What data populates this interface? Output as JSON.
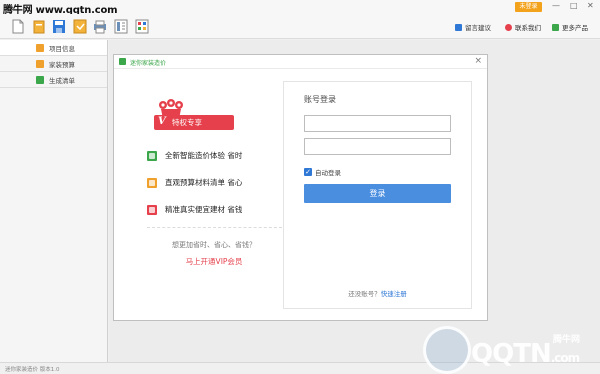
{
  "watermark_top": "腾牛网 www.qqtn.com",
  "titlebar": {
    "login_chip": "未登录",
    "min": "—",
    "max": "□",
    "close": "✕"
  },
  "toolbar": {
    "icons": [
      "new-file-icon",
      "open-folder-icon",
      "save-icon",
      "save-as-icon",
      "print-icon",
      "export-icon",
      "calculator-icon"
    ],
    "right": [
      {
        "icon": "message-icon",
        "label": "留言建议",
        "color": "#2f78d6"
      },
      {
        "icon": "phone-icon",
        "label": "联系我们",
        "color": "#e5404b"
      },
      {
        "icon": "more-products-icon",
        "label": "更多产品",
        "color": "#3ba64a"
      }
    ]
  },
  "sidebar": {
    "items": [
      {
        "label": "项目信息",
        "color": "#f0a02c",
        "active": true
      },
      {
        "label": "家装预算",
        "color": "#f0a02c",
        "active": false
      },
      {
        "label": "生成清单",
        "color": "#3ba64a",
        "active": false
      }
    ]
  },
  "dialog": {
    "title": "迷你家装造价",
    "close": "×",
    "vip": {
      "badge_v": "V",
      "badge_label": "特权专享"
    },
    "features": [
      {
        "text": "全新智能造价体验 省时",
        "color": "#3ba64a"
      },
      {
        "text": "直观预算材料清单 省心",
        "color": "#f0a02c"
      },
      {
        "text": "精准真实便宜建材 省钱",
        "color": "#e5404b"
      }
    ],
    "promo_question": "想更加省时、省心、省钱？",
    "promo_link": "马上开通VIP会员",
    "login": {
      "title": "账号登录",
      "username_value": "",
      "password_value": "",
      "auto_login": "自动登录",
      "auto_login_checked": true,
      "submit": "登录",
      "no_account": "还没账号？",
      "register": "快速注册"
    }
  },
  "statusbar": {
    "text": "迷你家装造价   版本1.0"
  },
  "watermark_bottom": {
    "brand": "QQTN",
    "suffix": ".com",
    "cn": "腾牛网"
  }
}
